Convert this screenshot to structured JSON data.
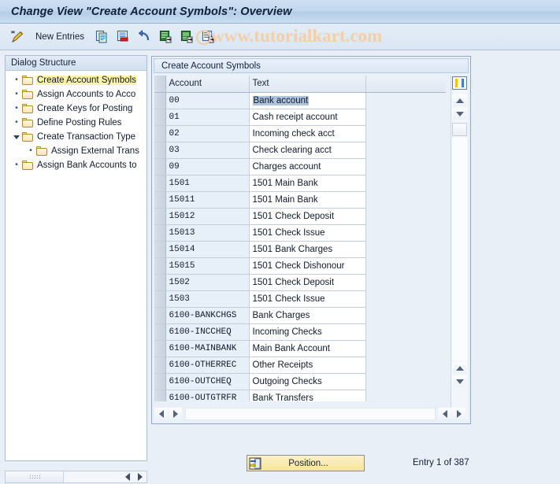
{
  "window": {
    "title": "Change View \"Create Account Symbols\": Overview"
  },
  "watermark": {
    "text": "www.tutorialkart.com"
  },
  "toolbar": {
    "change_icon": "pencil-icon",
    "new_entries_label": "New Entries",
    "buttons": [
      {
        "name": "copy-as-icon",
        "tooltip": "Copy As..."
      },
      {
        "name": "delete-icon",
        "tooltip": "Delete"
      },
      {
        "name": "undo-icon",
        "tooltip": "Undo Change"
      },
      {
        "name": "select-all-icon",
        "tooltip": "Select All"
      },
      {
        "name": "select-block-icon",
        "tooltip": "Select Block"
      },
      {
        "name": "deselect-all-icon",
        "tooltip": "Deselect All"
      }
    ]
  },
  "sidebar": {
    "header": "Dialog Structure",
    "items": [
      {
        "label": "Create Account Symbols",
        "level": 0,
        "selected": true,
        "expander": "bullet",
        "folder": "open"
      },
      {
        "label": "Assign Accounts to Acco",
        "level": 0,
        "selected": false,
        "expander": "bullet",
        "folder": "closed"
      },
      {
        "label": "Create Keys for Posting",
        "level": 0,
        "selected": false,
        "expander": "bullet",
        "folder": "closed"
      },
      {
        "label": "Define Posting Rules",
        "level": 0,
        "selected": false,
        "expander": "bullet",
        "folder": "closed"
      },
      {
        "label": "Create Transaction Type",
        "level": 0,
        "selected": false,
        "expander": "triangle",
        "folder": "closed"
      },
      {
        "label": "Assign External Trans",
        "level": 1,
        "selected": false,
        "expander": "bullet",
        "folder": "closed"
      },
      {
        "label": "Assign Bank Accounts to",
        "level": 0,
        "selected": false,
        "expander": "bullet",
        "folder": "closed"
      }
    ]
  },
  "table": {
    "header": "Create Account Symbols",
    "columns": [
      "Account",
      "Text"
    ],
    "selected_cell_row": 0,
    "rows": [
      {
        "account": "00",
        "text": "Bank account"
      },
      {
        "account": "01",
        "text": "Cash receipt account"
      },
      {
        "account": "02",
        "text": "Incoming check acct"
      },
      {
        "account": "03",
        "text": "Check clearing acct"
      },
      {
        "account": "09",
        "text": "Charges account"
      },
      {
        "account": "1501",
        "text": "1501 Main Bank"
      },
      {
        "account": "15011",
        "text": "1501 Main Bank"
      },
      {
        "account": "15012",
        "text": "1501 Check Deposit"
      },
      {
        "account": "15013",
        "text": "1501 Check Issue"
      },
      {
        "account": "15014",
        "text": "1501 Bank Charges"
      },
      {
        "account": "15015",
        "text": "1501 Check Dishonour"
      },
      {
        "account": "1502",
        "text": "1501 Check Deposit"
      },
      {
        "account": "1503",
        "text": "1501 Check Issue"
      },
      {
        "account": "6100-BANKCHGS",
        "text": "Bank Charges"
      },
      {
        "account": "6100-INCCHEQ",
        "text": "Incoming Checks"
      },
      {
        "account": "6100-MAINBANK",
        "text": "Main Bank Account"
      },
      {
        "account": "6100-OTHERREC",
        "text": "Other Receipts"
      },
      {
        "account": "6100-OUTCHEQ",
        "text": "Outgoing Checks"
      },
      {
        "account": "6100-OUTGTRFR",
        "text": "Bank Transfers"
      }
    ]
  },
  "footer": {
    "position_button": "Position...",
    "entry_status": "Entry 1 of 387"
  },
  "colors": {
    "title_bar": "#c2d7ee",
    "selection_highlight": "#aec4dc",
    "tree_selection": "#fcf3a8",
    "button_yellow": "#f6e49f",
    "watermark": "#f2cfa6"
  }
}
